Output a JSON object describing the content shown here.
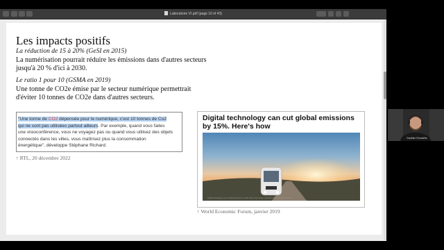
{
  "toolbar": {
    "title": "Laboratoire VI.pdf (page 10 of 43)"
  },
  "slide": {
    "title": "Les impacts positifs",
    "section1_sub": "La réduction de 15 à 20% (GeSI en 2015)",
    "section1_text": "La numérisation pourrait réduire les émissions dans d'autres secteurs jusqu'à 20 % d'ici à 2030.",
    "section2_sub": "Le ratio 1 pour 10 (GSMA en 2019)",
    "section2_text": "Une tonne de CO2e émise par le secteur numérique permettrait d'éviter 10 tonnes de CO2e dans d'autres secteurs.",
    "quote_part1": "\"Une tonne de ",
    "quote_co2": "CO2",
    "quote_part2": " dépensée pour le numérique, c'est 10 tonnes de Co2 qui ne sont pas utilisées partout ailleurs",
    "quote_rest": ". Par exemple, quand vous faites une visioconférence, vous ne voyagez pas ou quand vous utilisez des objets connectés dans les villes, vous maîtrisez plus la consommation énergétique\", développe Stéphane Richard.",
    "quote_caption": "↑ RTL, 20 décembre 2022",
    "wef_title": "Digital technology can cut global emissions by 15%. Here's how",
    "wef_credit": "Digital technologies can cut global emissions by 15%. Here's how. Image: Unsplash / World Economic Forum",
    "wef_caption": "↑ World Economic Forum, janvier 2019"
  },
  "webcam": {
    "name": "Gauthier Roussilhe"
  },
  "colors": {
    "highlight": "#b7d3f2",
    "co2_red": "#d04545",
    "toolbar": "#3b3b3b"
  },
  "icons": [
    "pdf-document-icon",
    "sidebar-toggle-icon",
    "zoom-out-icon",
    "zoom-in-icon",
    "pen-icon",
    "rotate-icon",
    "share-icon",
    "search-icon"
  ]
}
